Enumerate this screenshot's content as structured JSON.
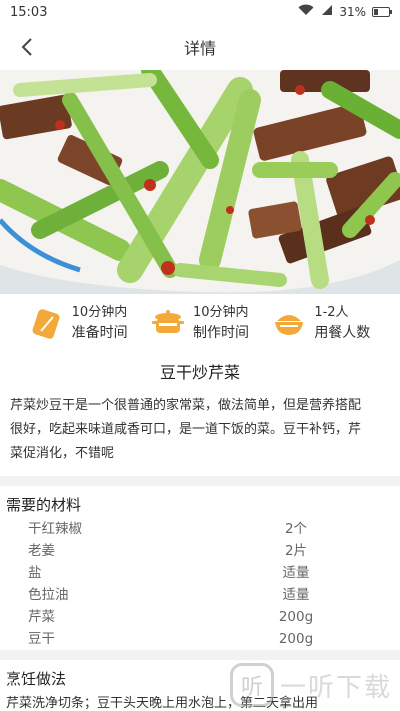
{
  "status": {
    "time": "15:03",
    "battery": "31%",
    "battery_level": 0.31
  },
  "nav": {
    "title": "详情"
  },
  "meta": [
    {
      "value": "10分钟内",
      "label": "准备时间",
      "icon": "prep-time-icon"
    },
    {
      "value": "10分钟内",
      "label": "制作时间",
      "icon": "cooking-pot-icon"
    },
    {
      "value": "1-2人",
      "label": "用餐人数",
      "icon": "rice-bowl-icon"
    }
  ],
  "dish": {
    "title": "豆干炒芹菜",
    "description_lines": [
      "芹菜炒豆干是一个很普通的家常菜，做法简单，但是营养搭配",
      "很好，吃起来味道咸香可口，是一道下饭的菜。豆干补钙，芹",
      "菜促消化，不错呢"
    ]
  },
  "materials": {
    "title": "需要的材料",
    "items": [
      {
        "name": "干红辣椒",
        "amount": "2个"
      },
      {
        "name": "老姜",
        "amount": "2片"
      },
      {
        "name": "盐",
        "amount": "适量"
      },
      {
        "name": "色拉油",
        "amount": "适量"
      },
      {
        "name": "芹菜",
        "amount": "200g"
      },
      {
        "name": "豆干",
        "amount": "200g"
      }
    ]
  },
  "method": {
    "title": "烹饪做法",
    "first_step": "芹菜洗净切条；豆干头天晚上用水泡上，第二天拿出用"
  },
  "watermark": {
    "text": "一听下载",
    "logo": "听"
  }
}
